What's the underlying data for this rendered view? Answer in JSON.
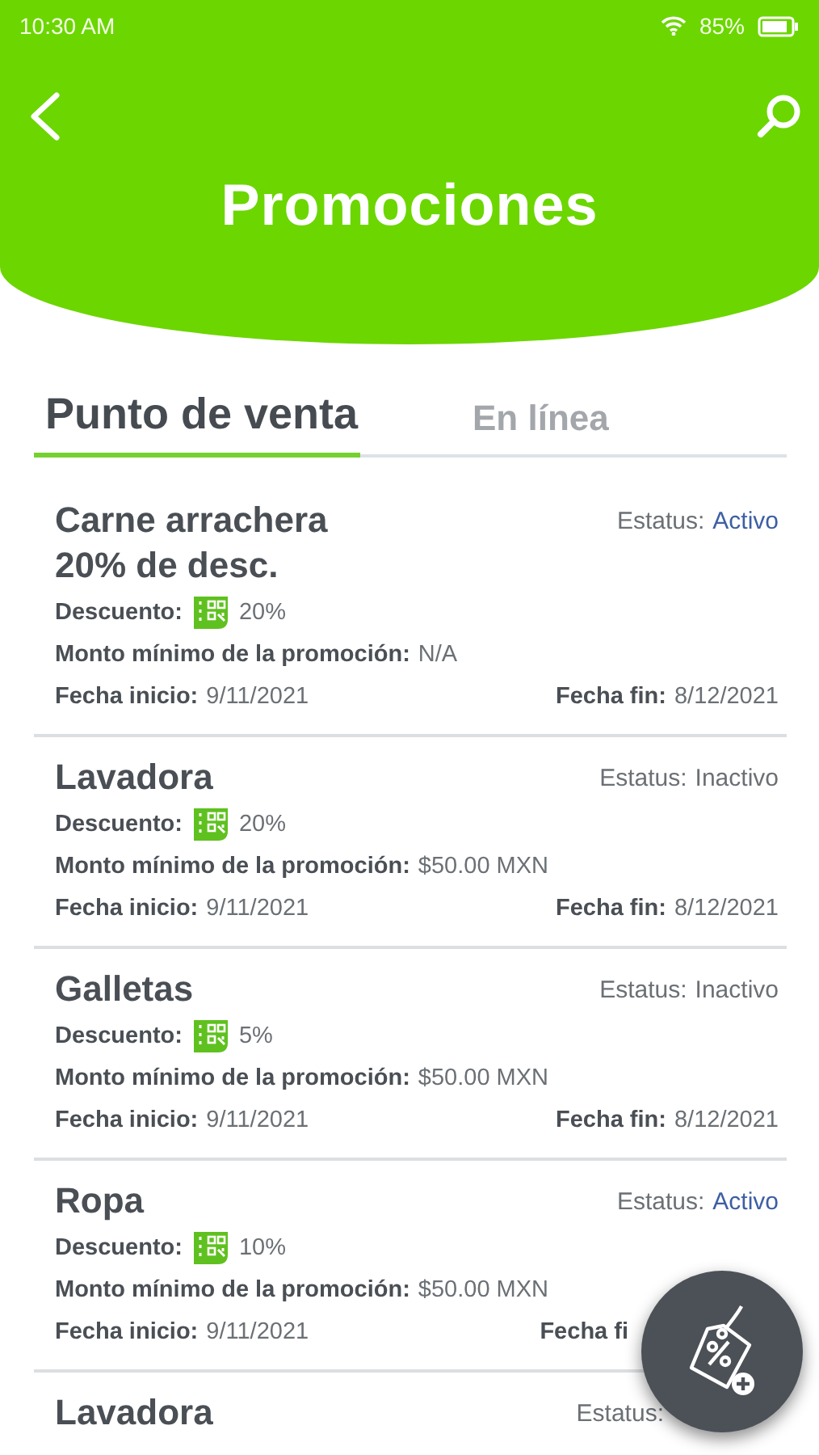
{
  "status_bar": {
    "time": "10:30 AM",
    "battery": "85%"
  },
  "header": {
    "title": "Promociones"
  },
  "tabs": [
    {
      "label": "Punto de venta",
      "selected": true
    },
    {
      "label": "En línea",
      "selected": false
    }
  ],
  "promotions": [
    {
      "title": "Carne arrachera 20% de desc.",
      "status_label": "Estatus:",
      "status": "Activo",
      "active": true,
      "discount_label": "Descuento:",
      "discount": "20%",
      "min_label": "Monto mínimo de la promoción:",
      "min": "N/A",
      "start_label": "Fecha inicio:",
      "start": "9/11/2021",
      "end_label": "Fecha fin:",
      "end": "8/12/2021"
    },
    {
      "title": "Lavadora",
      "status_label": "Estatus:",
      "status": "Inactivo",
      "active": false,
      "discount_label": "Descuento:",
      "discount": "20%",
      "min_label": "Monto mínimo de la promoción:",
      "min": "$50.00 MXN",
      "start_label": "Fecha inicio:",
      "start": "9/11/2021",
      "end_label": "Fecha fin:",
      "end": "8/12/2021"
    },
    {
      "title": "Galletas",
      "status_label": "Estatus:",
      "status": "Inactivo",
      "active": false,
      "discount_label": "Descuento:",
      "discount": "5%",
      "min_label": "Monto mínimo de la promoción:",
      "min": "$50.00 MXN",
      "start_label": "Fecha inicio:",
      "start": "9/11/2021",
      "end_label": "Fecha fin:",
      "end": "8/12/2021"
    },
    {
      "title": "Ropa",
      "status_label": "Estatus:",
      "status": "Activo",
      "active": true,
      "discount_label": "Descuento:",
      "discount": "10%",
      "min_label": "Monto mínimo de la promoción:",
      "min": "$50.00 MXN",
      "start_label": "Fecha inicio:",
      "start": "9/11/2021",
      "end_label": "Fecha fi"
    },
    {
      "title": "Lavadora",
      "status_label": "Estatus:"
    }
  ]
}
